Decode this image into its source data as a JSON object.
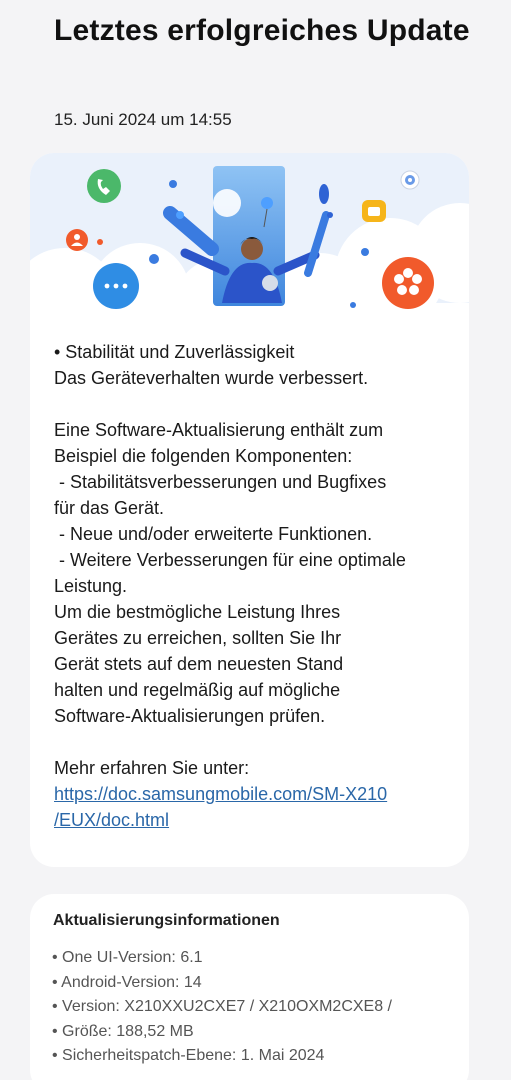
{
  "header": {
    "title": "Letztes erfolgreiches Update",
    "date": "15. Juni 2024 um 14:55"
  },
  "notes": {
    "lines": [
      "• Stabilität und Zuverlässigkeit",
      "Das Geräteverhalten wurde verbessert.",
      "",
      "Eine Software-Aktualisierung enthält zum",
      "Beispiel die folgenden Komponenten:",
      " - Stabilitätsverbesserungen und Bugfixes",
      "für das Gerät.",
      " - Neue und/oder erweiterte Funktionen.",
      " - Weitere Verbesserungen für eine optimale",
      "Leistung.",
      "Um die bestmögliche Leistung Ihres",
      "Gerätes zu erreichen, sollten Sie Ihr",
      "Gerät stets auf dem neuesten Stand",
      "halten und regelmäßig auf mögliche",
      "Software-Aktualisierungen prüfen.",
      "",
      "Mehr erfahren Sie unter:"
    ],
    "link_line1": "https://doc.samsungmobile.com/SM-X210",
    "link_line2": "/EUX/doc.html"
  },
  "info": {
    "title": "Aktualisierungsinformationen",
    "items": [
      "• One UI-Version: 6.1",
      "• Android-Version: 14",
      "• Version: X210XXU2CXE7 / X210OXM2CXE8 /",
      "• Größe: 188,52 MB",
      "• Sicherheitspatch-Ebene: 1. Mai 2024"
    ]
  },
  "hero": {
    "icons": [
      "phone-icon",
      "person-icon",
      "chat-icon",
      "settings-icon",
      "folder-icon",
      "flower-icon"
    ],
    "colors": {
      "sky": "#4a8fe0",
      "green": "#4bb86a",
      "orange": "#f15a2b",
      "blue": "#3a7be0",
      "yellow": "#f6b51a"
    }
  }
}
